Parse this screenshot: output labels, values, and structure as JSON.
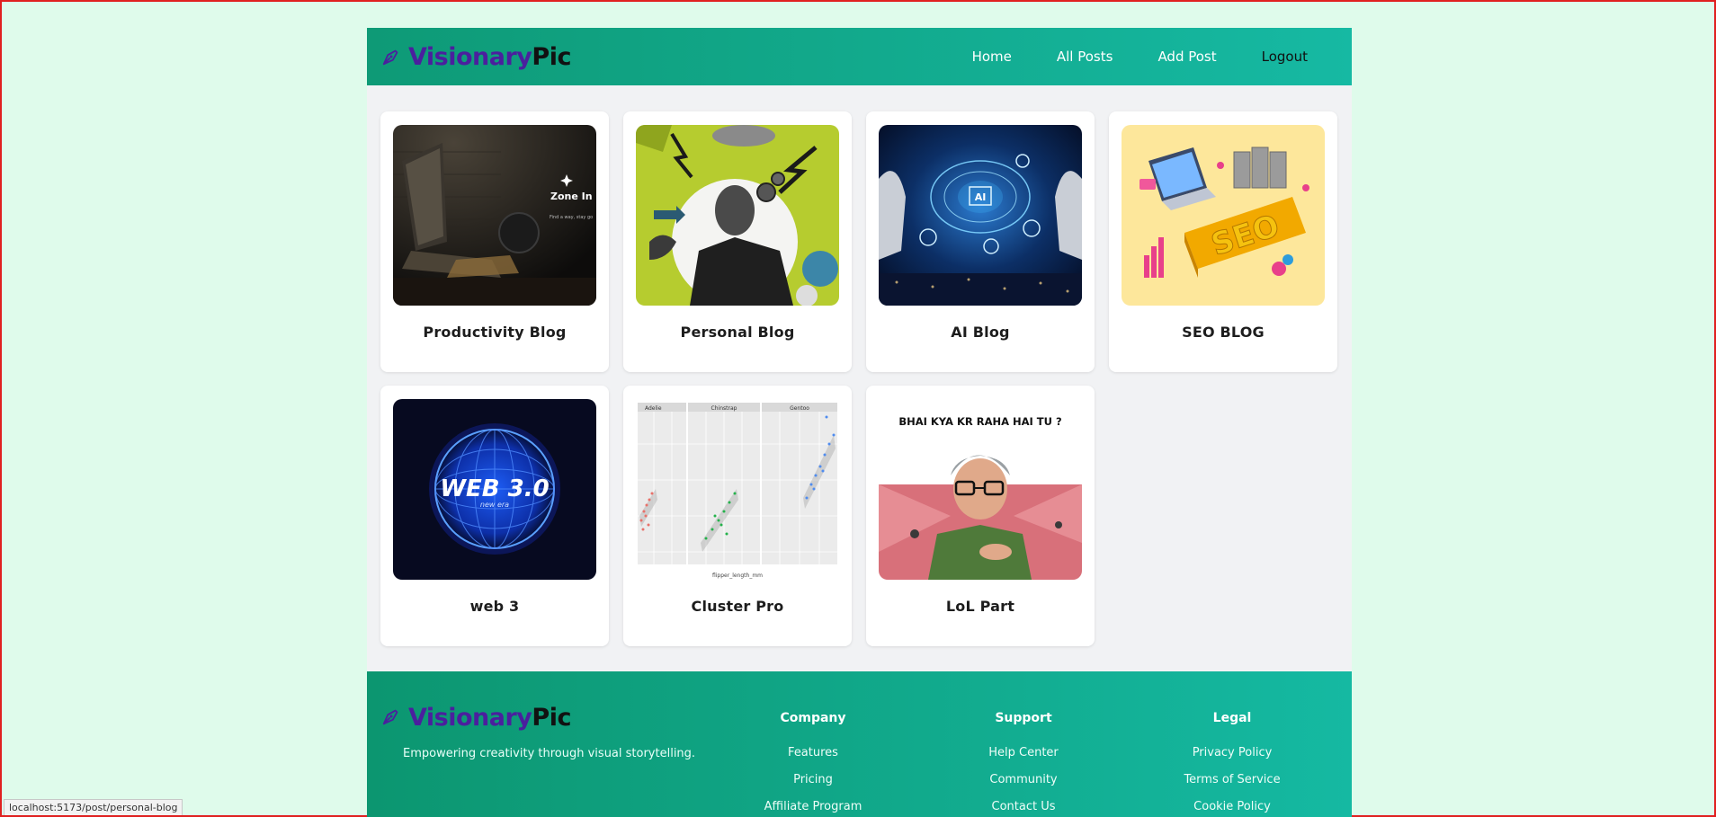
{
  "brand": {
    "part1": "Visionary",
    "part2": "Pic",
    "primary_color": "#4b1f9e"
  },
  "nav": {
    "items": [
      "Home",
      "All Posts",
      "Add Post",
      "Logout"
    ]
  },
  "posts": [
    {
      "title": "Productivity Blog",
      "image_text": "Zone In",
      "image_subtext": "Find a way, stay go"
    },
    {
      "title": "Personal Blog"
    },
    {
      "title": "AI Blog",
      "image_text": "AI"
    },
    {
      "title": "SEO BLOG",
      "image_text": "SEO"
    },
    {
      "title": "web 3",
      "image_text": "WEB 3.0",
      "image_subtext": "new era"
    },
    {
      "title": "Cluster Pro",
      "image_panels": [
        "Adelie",
        "Chinstrap",
        "Gentoo"
      ],
      "image_xlabel": "flipper_length_mm"
    },
    {
      "title": "LoL Part",
      "image_text": "BHAI KYA KR RAHA HAI TU ?"
    }
  ],
  "footer": {
    "tagline": "Empowering creativity through visual storytelling.",
    "columns": [
      {
        "heading": "Company",
        "links": [
          "Features",
          "Pricing",
          "Affiliate Program"
        ]
      },
      {
        "heading": "Support",
        "links": [
          "Help Center",
          "Community",
          "Contact Us"
        ]
      },
      {
        "heading": "Legal",
        "links": [
          "Privacy Policy",
          "Terms of Service",
          "Cookie Policy"
        ]
      }
    ]
  },
  "status_url": "localhost:5173/post/personal-blog",
  "colors": {
    "page_bg": "#dffbeb",
    "header_start": "#0e9a76",
    "header_end": "#16b9a3"
  }
}
